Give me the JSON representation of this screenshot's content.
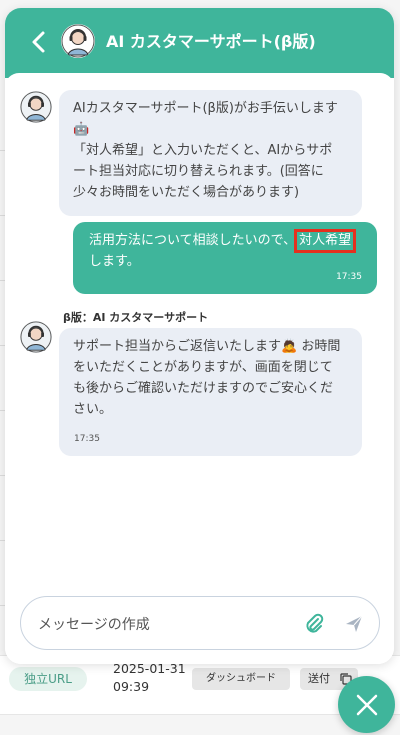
{
  "header": {
    "title": "AI カスタマーサポート(β版)"
  },
  "messages": [
    {
      "role": "bot",
      "lines": [
        "AIカスタマーサポート(β版)がお手伝いします",
        "🤖",
        "「対人希望」と入力いただくと、AIからサポ",
        "ート担当対応に切り替えられます。(回答に",
        "少々お時間をいただく場合があります)"
      ]
    },
    {
      "role": "user",
      "text_before": "活用方法について相談したいので、",
      "highlight": "対人希望",
      "text_after": "します。",
      "time": "17:35"
    },
    {
      "role": "bot",
      "sender": "β版：AI カスタマーサポート",
      "lines": [
        "サポート担当からご返信いたします🙇 お時間",
        "をいただくことがありますが、画面を閉じて",
        "も後からご確認いただけますのでご安心くだ",
        "さい。"
      ],
      "time": "17:35"
    }
  ],
  "composer": {
    "placeholder": "メッセージの作成"
  },
  "background_row": {
    "tag": "独立URL",
    "date": "2025-01-31",
    "time": "09:39",
    "dashboard_label": "ダッシュボード",
    "send_label": "送付"
  },
  "colors": {
    "accent": "#3fb59b",
    "bot_bubble": "#eaeef5",
    "highlight_border": "#e5301e"
  }
}
